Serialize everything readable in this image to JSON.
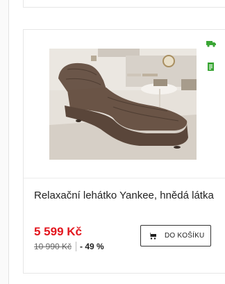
{
  "product": {
    "title": "Relaxační lehátko Yankee, hnědá látka",
    "price": "5 599 Kč",
    "old_price": "10 990 Kč",
    "discount": "- 49 %",
    "cart_button_label": "DO KOŠÍKU"
  },
  "icons": {
    "delivery": "truck-icon",
    "stock": "document-icon",
    "cart": "cart-icon"
  },
  "colors": {
    "price": "#e3161e",
    "availability_icons": "#3aa635"
  }
}
